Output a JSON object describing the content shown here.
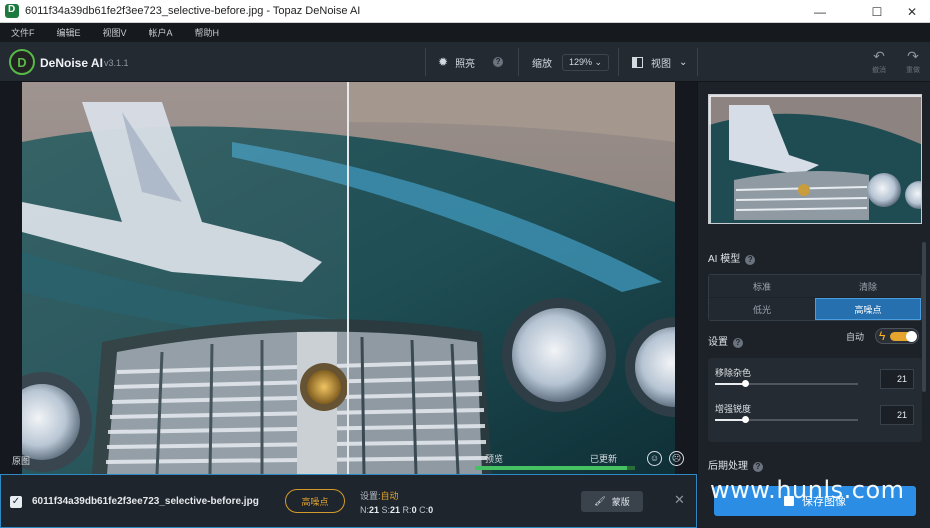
{
  "window": {
    "title": "6011f34a39db61fe2f3ee723_selective-before.jpg - Topaz DeNoise AI",
    "minimize": "—",
    "maximize": "☐",
    "close": "✕"
  },
  "menu": [
    "文件F",
    "编辑E",
    "视图V",
    "帐户A",
    "帮助H"
  ],
  "toolbar": {
    "brand": "DeNoise AI",
    "version": "v3.1.1",
    "brightness_label": "照亮",
    "zoom_label": "缩放",
    "zoom_value": "129%",
    "view_label": "视图",
    "undo_label": "撤消",
    "redo_label": "重做"
  },
  "canvas": {
    "original_tag": "原图",
    "preview_tag": "预览",
    "updated_tag": "已更新",
    "progress": 0.95
  },
  "file": {
    "name": "6011f34a39db61fe2f3ee723_selective-before.jpg",
    "mode": "高噪点",
    "settings_label": "设置:",
    "settings_value": "自动",
    "stats": {
      "N": "21",
      "S": "21",
      "R": "0",
      "C": "0"
    },
    "mask_label": "蒙版"
  },
  "panel": {
    "ai_model_title": "AI 模型",
    "modes": [
      "标准",
      "清除",
      "低光",
      "高噪点"
    ],
    "active_mode": "高噪点",
    "settings_title": "设置",
    "auto_label": "自动",
    "sliders": [
      {
        "label": "移除杂色",
        "value": "21",
        "fraction": 0.21
      },
      {
        "label": "增强锐度",
        "value": "21",
        "fraction": 0.21
      }
    ],
    "postprocess_title": "后期处理",
    "save_label": "保存图像"
  },
  "watermark": "www.hunls.com",
  "colors": {
    "accent": "#2b8ee4",
    "mode_orange": "#d39b2a",
    "progress": "#45c063"
  }
}
